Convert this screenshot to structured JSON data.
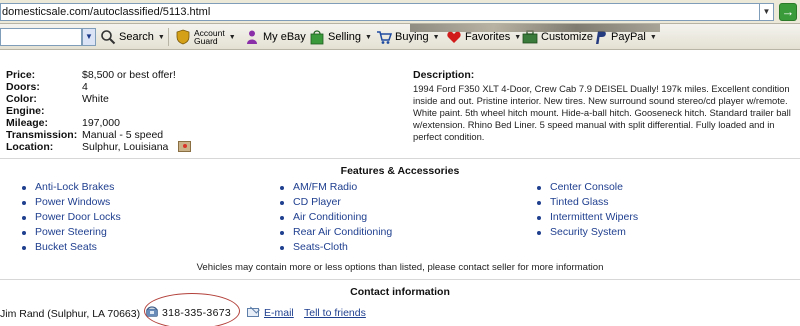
{
  "browser": {
    "address": "domesticsale.com/autoclassified/5113.html",
    "go_label": "→"
  },
  "toolbar": {
    "search_label": "Search",
    "account_guard_line1": "Account",
    "account_guard_line2": "Guard",
    "my_ebay_label": "My eBay",
    "selling_label": "Selling",
    "buying_label": "Buying",
    "favorites_label": "Favorites",
    "customize_label": "Customize",
    "paypal_label": "PayPal"
  },
  "specs": [
    {
      "label": "Price:",
      "value": "$8,500 or best offer!"
    },
    {
      "label": "Doors:",
      "value": "4"
    },
    {
      "label": "Color:",
      "value": "White"
    },
    {
      "label": "Engine:",
      "value": ""
    },
    {
      "label": "Mileage:",
      "value": "197,000"
    },
    {
      "label": "Transmission:",
      "value": "Manual - 5 speed"
    },
    {
      "label": "Location:",
      "value": "Sulphur, Louisiana"
    }
  ],
  "description": {
    "title": "Description:",
    "text": "1994 Ford F350 XLT 4-Door, Crew Cab 7.9 DEISEL Dually! 197k miles. Excellent condition inside and out. Pristine interior. New tires. New surround sound stereo/cd player w/remote. White paint. 5th wheel hitch mount. Hide-a-ball hitch. Gooseneck hitch. Standard trailer ball w/extension. Rhino Bed Liner. 5 speed manual with split differential. Fully loaded and in perfect condition."
  },
  "features": {
    "title": "Features & Accessories",
    "col1": [
      "Anti-Lock Brakes",
      "Power Windows",
      "Power Door Locks",
      "Power Steering",
      "Bucket Seats"
    ],
    "col2": [
      "AM/FM Radio",
      "CD Player",
      "Air Conditioning",
      "Rear Air Conditioning",
      "Seats-Cloth"
    ],
    "col3": [
      "Center Console",
      "Tinted Glass",
      "Intermittent Wipers",
      "Security System"
    ]
  },
  "disclaimer": "Vehicles may contain more or less options than listed, please contact seller for more information",
  "contact": {
    "title": "Contact information",
    "name": "Jim Rand (Sulphur, LA 70663)",
    "phone": "318-335-3673",
    "email_label": "E-mail",
    "friends_label": "Tell to friends"
  },
  "colors": {
    "link": "#1f3f8f",
    "annotation_circle": "#b3413b"
  }
}
